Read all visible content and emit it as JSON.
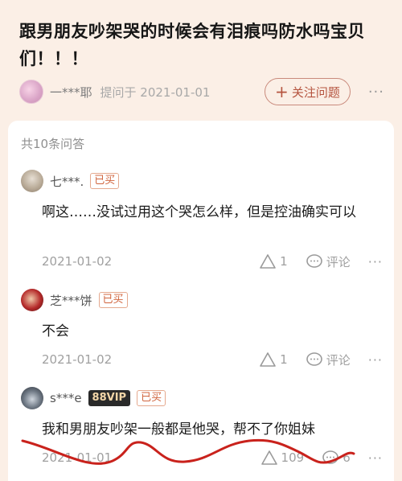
{
  "question": {
    "title_line1": "跟男朋友吵架哭的时候会有泪痕吗防水吗宝贝",
    "title_line2": "们！！！",
    "asker": "一***耶",
    "asked_on": "提问于 2021-01-01",
    "follow_label": "关注问题",
    "more": "···"
  },
  "answers_count": "共10条问答",
  "answers": [
    {
      "user": "七***.",
      "badge": "已买",
      "text": "啊这……没试过用这个哭怎么样，但是控油确实可以",
      "date": "2021-01-02",
      "likes": "1",
      "comment": "评论",
      "more": "···"
    },
    {
      "user": "芝***饼",
      "badge": "已买",
      "text": "不会",
      "date": "2021-01-02",
      "likes": "1",
      "comment": "评论",
      "more": "···"
    },
    {
      "user": "s***e",
      "vip": "88VIP",
      "badge": "已买",
      "text": "我和男朋友吵架一般都是他哭，帮不了你姐妹",
      "date": "2021-01-01",
      "likes": "109",
      "comments": "6",
      "more": "···"
    }
  ],
  "colors": {
    "accent": "#b5543f",
    "background": "#fbefe6",
    "scribble": "#c9221c"
  }
}
